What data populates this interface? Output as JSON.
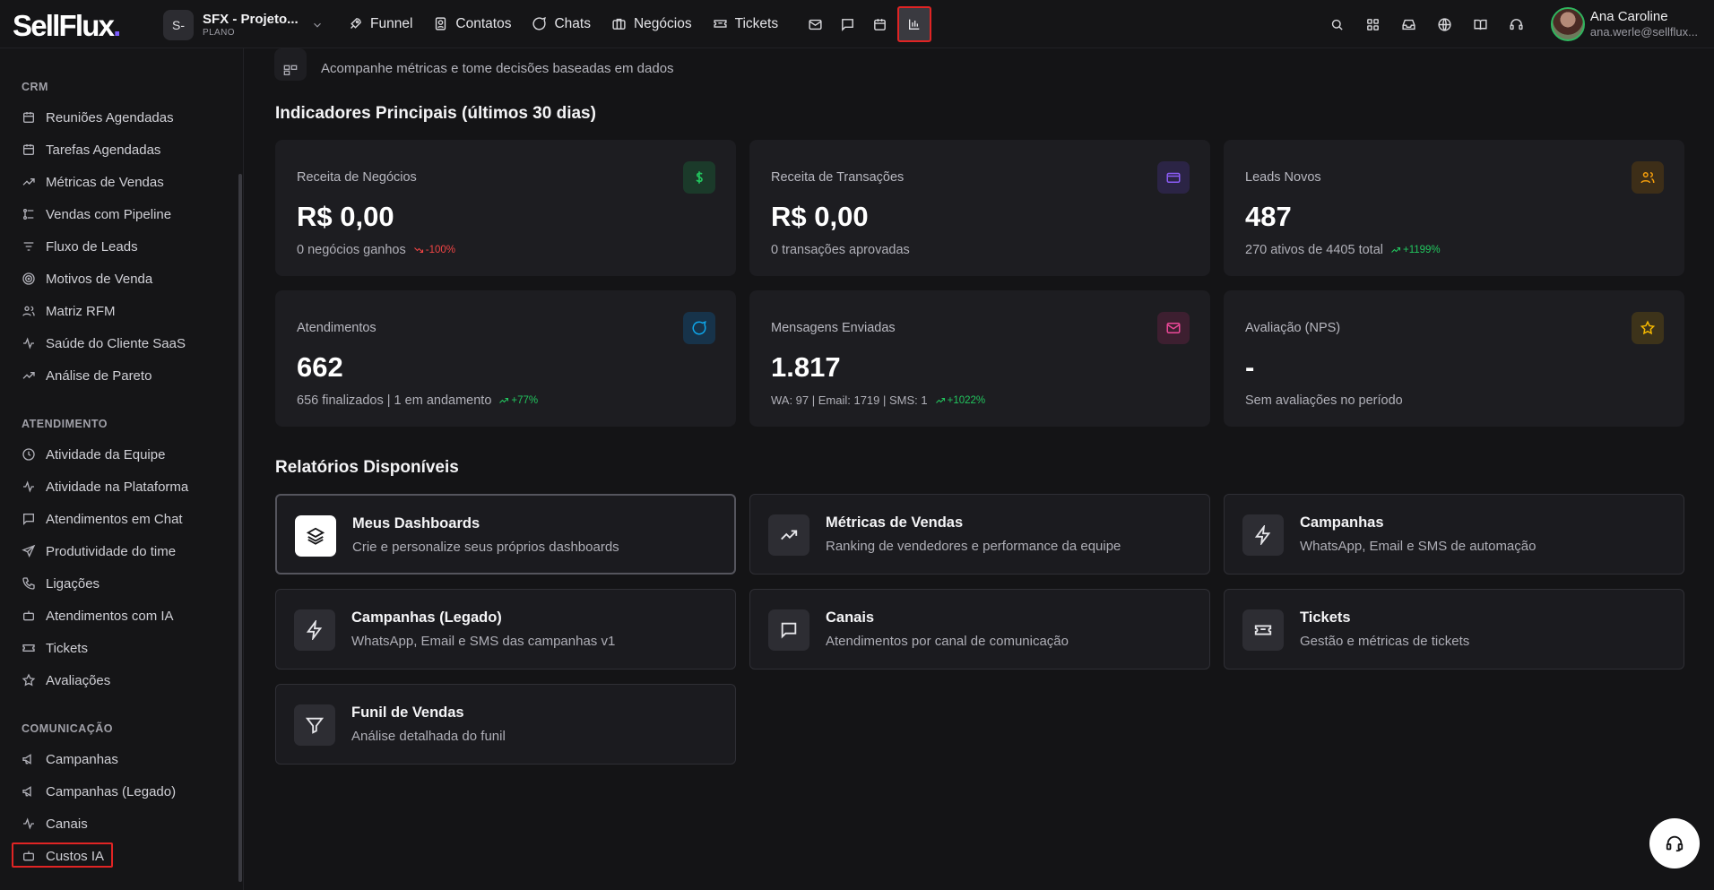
{
  "header": {
    "logo_main": "SellFlux",
    "logo_dot": ".",
    "project": {
      "badge": "S-",
      "name": "SFX - Projeto...",
      "plan": "PLANO"
    },
    "nav": [
      {
        "label": "Funnel",
        "icon": "rocket-icon"
      },
      {
        "label": "Contatos",
        "icon": "contact-icon"
      },
      {
        "label": "Chats",
        "icon": "chat-icon"
      },
      {
        "label": "Negócios",
        "icon": "briefcase-icon"
      },
      {
        "label": "Tickets",
        "icon": "ticket-icon"
      }
    ],
    "nav_icons": [
      "mail-icon",
      "message-icon",
      "calendar-icon",
      "reports-chart-icon"
    ],
    "right_icons": [
      "search-icon",
      "grid-icon",
      "inbox-icon",
      "globe-icon",
      "book-icon",
      "headset-icon"
    ],
    "user": {
      "name": "Ana Caroline",
      "email": "ana.werle@sellflux..."
    }
  },
  "sidebar": {
    "sections": [
      {
        "title": "CRM",
        "items": [
          "Reuniões Agendadas",
          "Tarefas Agendadas",
          "Métricas de Vendas",
          "Vendas com Pipeline",
          "Fluxo de Leads",
          "Motivos de Venda",
          "Matriz RFM",
          "Saúde do Cliente SaaS",
          "Análise de Pareto"
        ]
      },
      {
        "title": "ATENDIMENTO",
        "items": [
          "Atividade da Equipe",
          "Atividade na Plataforma",
          "Atendimentos em Chat",
          "Produtividade do time",
          "Ligações",
          "Atendimentos com IA",
          "Tickets",
          "Avaliações"
        ]
      },
      {
        "title": "COMUNICAÇÃO",
        "items": [
          "Campanhas",
          "Campanhas (Legado)",
          "Canais",
          "Custos IA"
        ]
      }
    ]
  },
  "main": {
    "page_subtitle": "Acompanhe métricas e tome decisões baseadas em dados",
    "kpi_title": "Indicadores Principais (últimos 30 dias)",
    "kpis": [
      {
        "label": "Receita de Negócios",
        "value": "R$ 0,00",
        "sub": "0 negócios ganhos",
        "delta": "-100%",
        "trend": "down",
        "icon": "dollar-icon",
        "color": "#22c55e",
        "bg": "#1b3a2a"
      },
      {
        "label": "Receita de Transações",
        "value": "R$ 0,00",
        "sub": "0 transações aprovadas",
        "delta": "",
        "trend": "",
        "icon": "credit-card-icon",
        "color": "#8b5cf6",
        "bg": "#2b2445"
      },
      {
        "label": "Leads Novos",
        "value": "487",
        "sub": "270 ativos de 4405 total",
        "delta": "+1199%",
        "trend": "up",
        "icon": "users-icon",
        "color": "#f59e0b",
        "bg": "#3d2e18"
      },
      {
        "label": "Atendimentos",
        "value": "662",
        "sub": "656 finalizados | 1 em andamento",
        "delta": "+77%",
        "trend": "up",
        "icon": "chat-bubble-icon",
        "color": "#0ea5e9",
        "bg": "#17334a"
      },
      {
        "label": "Mensagens Enviadas",
        "value": "1.817",
        "sub": "WA: 97 | Email: 1719 | SMS: 1",
        "delta": "+1022%",
        "trend": "up",
        "icon": "mail-icon",
        "color": "#ec4899",
        "bg": "#3d1f30"
      },
      {
        "label": "Avaliação (NPS)",
        "value": "-",
        "sub": "Sem avaliações no período",
        "delta": "",
        "trend": "",
        "icon": "star-icon",
        "color": "#f5b800",
        "bg": "#3d331a"
      }
    ],
    "reports_title": "Relatórios Disponíveis",
    "reports": [
      {
        "title": "Meus Dashboards",
        "desc": "Crie e personalize seus próprios dashboards",
        "icon": "layers-icon"
      },
      {
        "title": "Métricas de Vendas",
        "desc": "Ranking de vendedores e performance da equipe",
        "icon": "trending-up-icon"
      },
      {
        "title": "Campanhas",
        "desc": "WhatsApp, Email e SMS de automação",
        "icon": "lightning-icon"
      },
      {
        "title": "Campanhas (Legado)",
        "desc": "WhatsApp, Email e SMS das campanhas v1",
        "icon": "lightning-icon"
      },
      {
        "title": "Canais",
        "desc": "Atendimentos por canal de comunicação",
        "icon": "message-square-icon"
      },
      {
        "title": "Tickets",
        "desc": "Gestão e métricas de tickets",
        "icon": "ticket-icon"
      },
      {
        "title": "Funil de Vendas",
        "desc": "Análise detalhada do funil",
        "icon": "filter-icon"
      }
    ]
  }
}
